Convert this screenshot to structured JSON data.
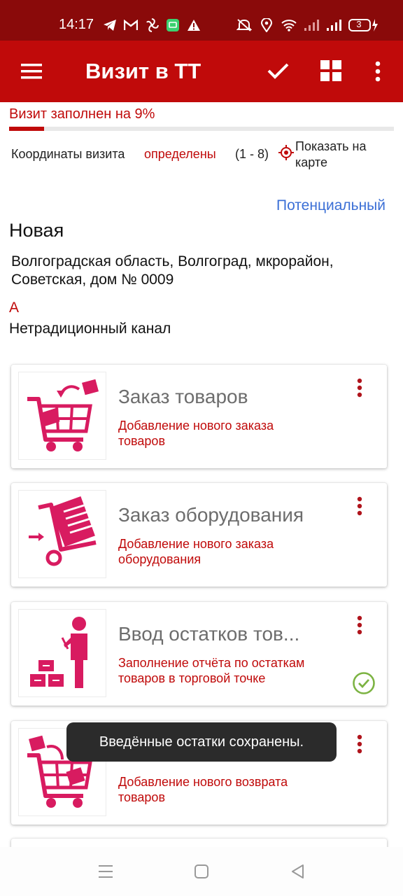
{
  "status_bar": {
    "time": "14:17",
    "left_icons": [
      "telegram-icon",
      "gmail-icon",
      "pinwheel-icon",
      "message-app-icon",
      "warning-icon"
    ],
    "right_icons": [
      "mute-icon",
      "location-icon",
      "wifi-icon",
      "signal-icon",
      "signal-icon",
      "battery-icon"
    ],
    "battery_level": "3"
  },
  "app_bar": {
    "title": "Визит в ТТ",
    "icons": [
      "menu-icon",
      "check-icon",
      "grid-icon",
      "more-vert-icon"
    ]
  },
  "progress": {
    "label": "Визит заполнен на 9%",
    "value": 0.09
  },
  "coords": {
    "label": "Координаты визита",
    "status": "определены",
    "range": "(1 - 8)",
    "map_link": "Показать на карте"
  },
  "outlet": {
    "type": "Потенциальный",
    "name": "Новая",
    "address": "Волгоградская область, Волгоград, мкрорайон, Советская, дом № 0009",
    "category": "А",
    "channel": "Нетрадиционный канал"
  },
  "cards": [
    {
      "title": "Заказ товаров",
      "desc": "Добавление нового заказа товаров",
      "icon": "shopping-cart-icon",
      "done": false
    },
    {
      "title": "Заказ оборудования",
      "desc": "Добавление нового заказа оборудования",
      "icon": "hand-truck-icon",
      "done": false
    },
    {
      "title": "Ввод остатков тов...",
      "desc": "Заполнение отчёта по остаткам товаров в торговой точке",
      "icon": "inventory-person-icon",
      "done": true
    },
    {
      "title": "",
      "desc": "Добавление нового возврата товаров",
      "icon": "return-cart-icon",
      "done": false
    }
  ],
  "toast": "Введённые остатки сохранены.",
  "nav": [
    "recents-icon",
    "home-icon",
    "back-icon"
  ],
  "colors": {
    "primary": "#c00a0a",
    "status_bar": "#8a0a0a",
    "accent_icon": "#d81b60",
    "link": "#3b6fd6",
    "done": "#7cb342"
  }
}
